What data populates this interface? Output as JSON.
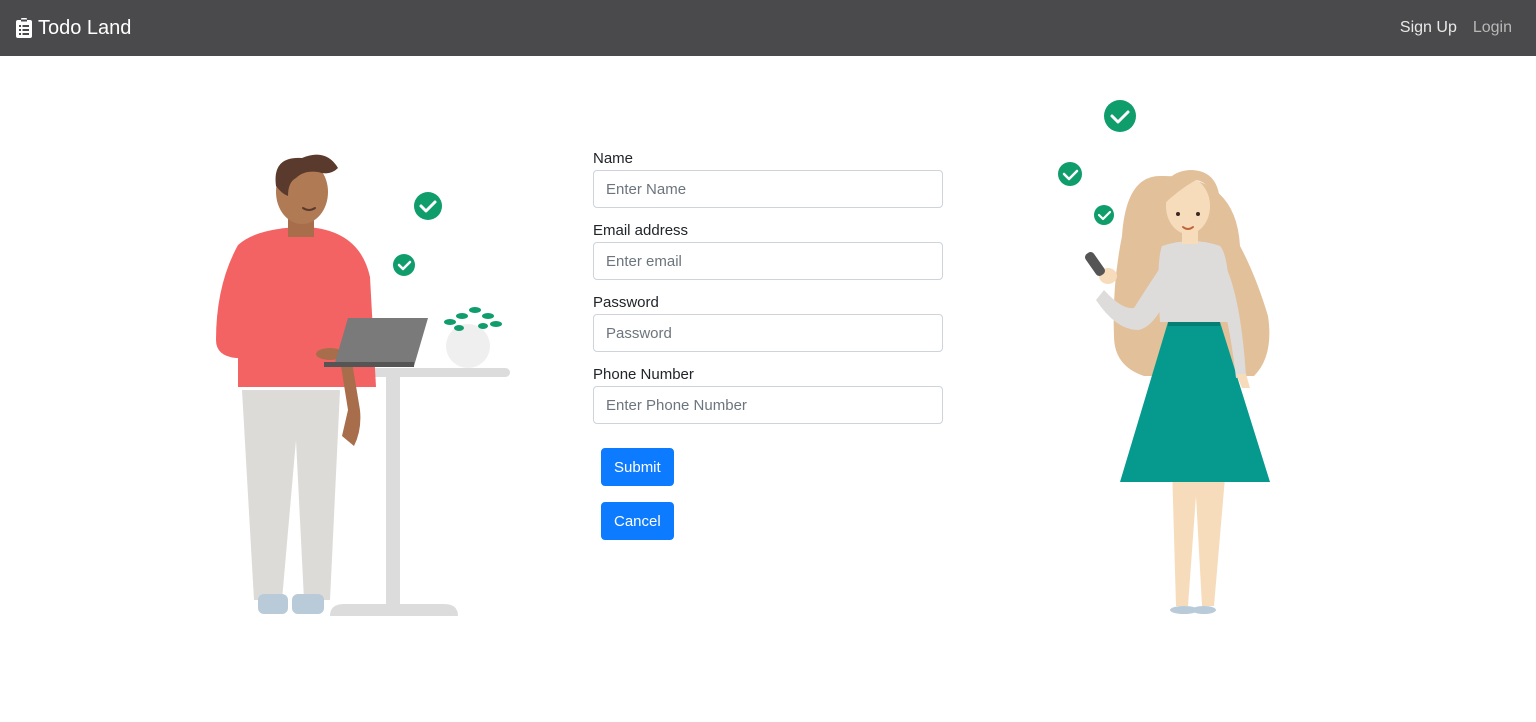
{
  "navbar": {
    "brand": "Todo Land",
    "brand_icon": "clipboard-list-icon",
    "links": [
      {
        "label": "Sign Up"
      },
      {
        "label": "Login"
      }
    ]
  },
  "form": {
    "fields": [
      {
        "label": "Name",
        "placeholder": "Enter Name",
        "type": "text"
      },
      {
        "label": "Email address",
        "placeholder": "Enter email",
        "type": "email"
      },
      {
        "label": "Password",
        "placeholder": "Password",
        "type": "password"
      },
      {
        "label": "Phone Number",
        "placeholder": "Enter Phone Number",
        "type": "tel"
      }
    ],
    "submit_label": "Submit",
    "cancel_label": "Cancel"
  },
  "colors": {
    "navbar_bg": "#4a4a4c",
    "primary": "#0d7bff",
    "check_green": "#0f9d6c"
  }
}
